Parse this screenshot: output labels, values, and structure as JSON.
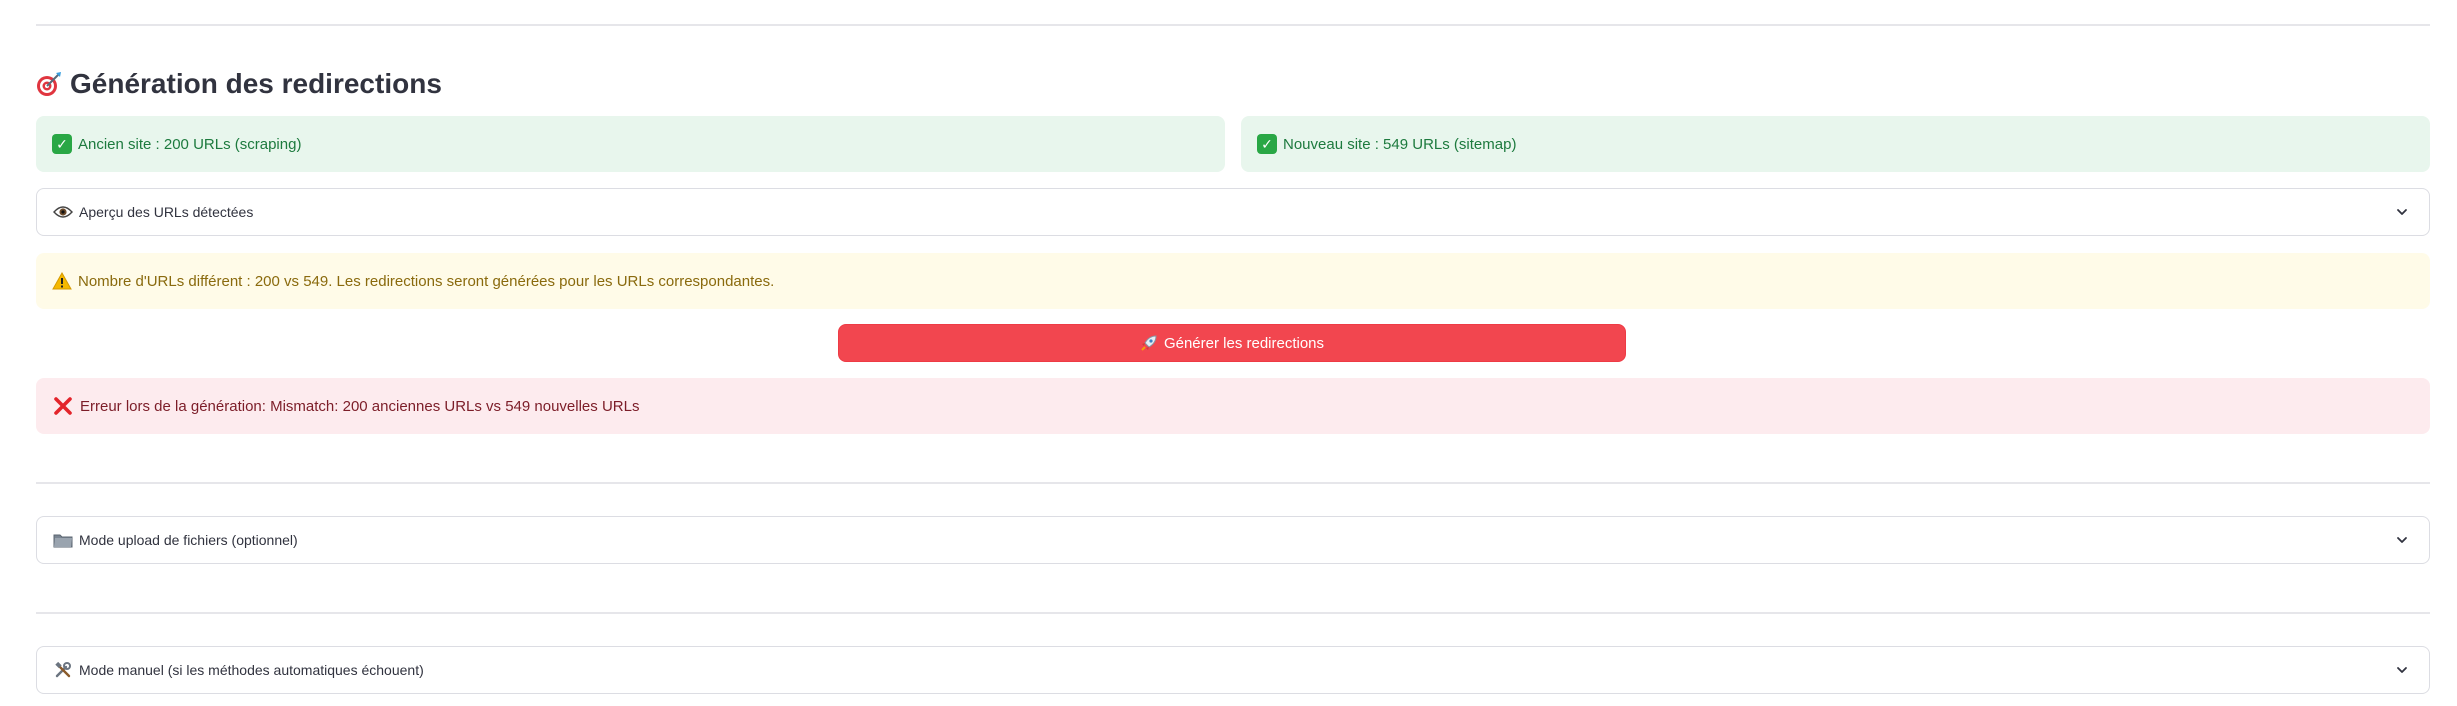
{
  "section": {
    "title": "Génération des redirections",
    "title_icon": "target-dart-icon"
  },
  "alerts": {
    "old_site": {
      "text": "Ancien site : 200 URLs (scraping)",
      "icon": "check-icon",
      "color": "#1d7a3e"
    },
    "new_site": {
      "text": "Nouveau site : 549 URLs (sitemap)",
      "icon": "check-icon",
      "color": "#1d7a3e"
    },
    "warning": {
      "text": "Nombre d'URLs différent : 200 vs 549. Les redirections seront générées pour les URLs correspondantes.",
      "icon": "warning-icon",
      "color": "#8a6a0d"
    },
    "error": {
      "text": "Erreur lors de la génération: Mismatch: 200 anciennes URLs vs 549 nouvelles URLs",
      "icon": "cross-icon",
      "color": "#7c1d28"
    }
  },
  "expanders": {
    "preview": {
      "label": "Aperçu des URLs détectées",
      "icon": "eye-icon"
    },
    "upload": {
      "label": "Mode upload de fichiers (optionnel)",
      "icon": "folder-icon"
    },
    "manual": {
      "label": "Mode manuel (si les méthodes automatiques échouent)",
      "icon": "tools-icon"
    }
  },
  "button": {
    "label": "Générer les redirections",
    "icon": "rocket-icon",
    "color": "#f2464f"
  }
}
